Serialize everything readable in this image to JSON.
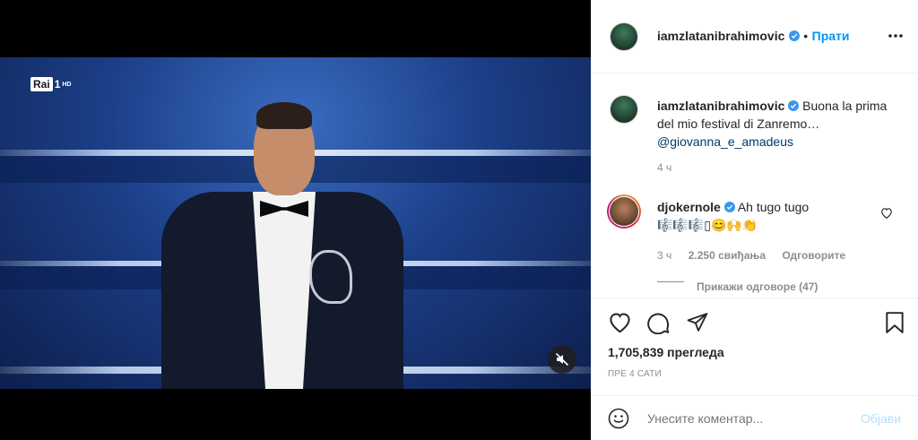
{
  "video": {
    "channel_logo_rai": "Rai",
    "channel_logo_num": "1",
    "channel_logo_hd": "HD",
    "mute_icon": "speaker-muted-icon"
  },
  "header": {
    "username": "iamzlatanibrahimovic",
    "separator": "•",
    "follow_label": "Прати",
    "more_icon": "more-dots-icon"
  },
  "caption": {
    "username": "iamzlatanibrahimovic",
    "text": "Buona la prima del mio festival di Zanremo…",
    "mention": "@giovanna_e_amadeus",
    "time": "4 ч"
  },
  "comment": {
    "username": "djokernole",
    "text": "Ah tugo tugo",
    "emojis": "🎼🎼🎼▯😊🙌👏",
    "time": "3 ч",
    "likes": "2.250 свиђања",
    "reply_label": "Одговорите",
    "view_replies": "Прикажи одговоре (47)"
  },
  "actions": {
    "views": "1,705,839 прегледа",
    "timestamp": "ПРЕ 4 САТИ"
  },
  "add_comment": {
    "placeholder": "Унесите коментар...",
    "post_label": "Објави"
  },
  "colors": {
    "accent_blue": "#0095f6",
    "mention_blue": "#00376b",
    "muted_text": "#8e8e8e",
    "verified_blue": "#3897f0"
  }
}
